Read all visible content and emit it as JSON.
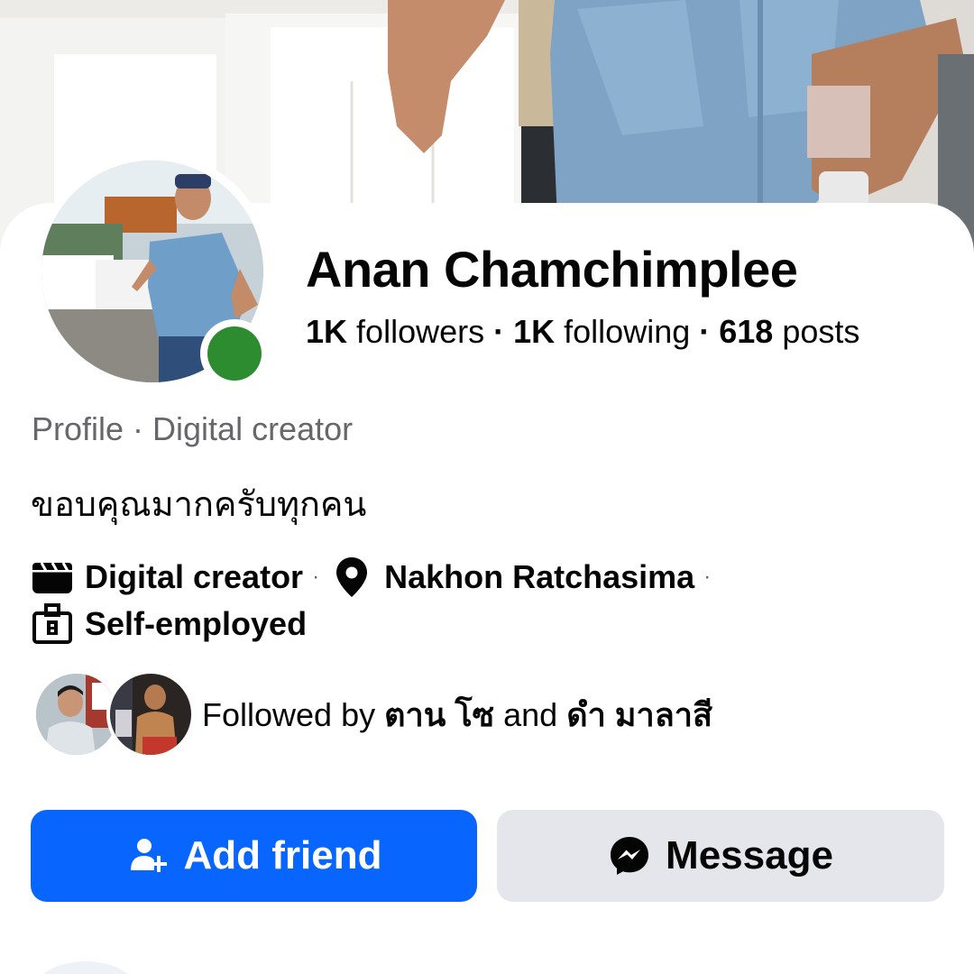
{
  "profile": {
    "name": "Anan Chamchimplee",
    "followers_count": "1K",
    "followers_label": "followers",
    "following_count": "1K",
    "following_label": "following",
    "posts_count": "618",
    "posts_label": "posts",
    "separator": "·",
    "online": true,
    "subtitle": "Profile · Digital creator",
    "bio": "ขอบคุณมากครับทุกคน"
  },
  "details": {
    "category": "Digital creator",
    "category_icon": "clapperboard-icon",
    "location": "Nakhon Ratchasima",
    "location_icon": "location-pin-icon",
    "work": "Self-employed",
    "work_icon": "briefcase-icon",
    "dot": "·"
  },
  "mutual": {
    "prefix": "Followed by",
    "person1": "ตาน โซ",
    "conjunction": "and",
    "person2": "ดำ มาลาสี"
  },
  "actions": {
    "add_friend_label": "Add friend",
    "add_friend_icon": "add-person-icon",
    "message_label": "Message",
    "message_icon": "messenger-icon"
  },
  "colors": {
    "primary": "#0866ff",
    "secondary_button": "#e4e6eb",
    "online": "#2c8c2f",
    "muted_text": "#65676b"
  }
}
